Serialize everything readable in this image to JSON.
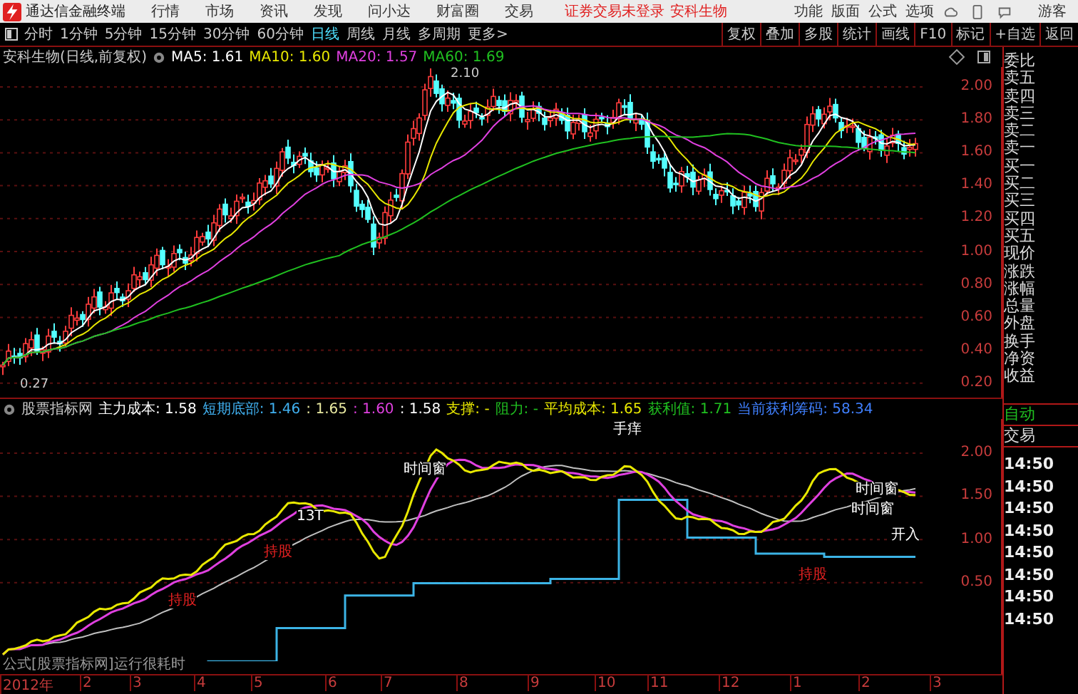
{
  "app": {
    "title": "通达信金融终端"
  },
  "menu": [
    "行情",
    "市场",
    "资讯",
    "发现",
    "问小达",
    "财富圈",
    "交易"
  ],
  "notice": [
    {
      "text": "证券交易未登录"
    },
    {
      "text": "安科生物"
    }
  ],
  "right_menu": [
    "功能",
    "版面",
    "公式",
    "选项"
  ],
  "user": "游客",
  "periods": [
    {
      "label": "分时",
      "selected": false
    },
    {
      "label": "1分钟",
      "selected": false
    },
    {
      "label": "5分钟",
      "selected": false
    },
    {
      "label": "15分钟",
      "selected": false
    },
    {
      "label": "30分钟",
      "selected": false
    },
    {
      "label": "60分钟",
      "selected": false
    },
    {
      "label": "日线",
      "selected": true
    },
    {
      "label": "周线",
      "selected": false
    },
    {
      "label": "月线",
      "selected": false
    },
    {
      "label": "多周期",
      "selected": false
    },
    {
      "label": "更多>",
      "selected": false
    }
  ],
  "tools": [
    "复权",
    "叠加",
    "多股",
    "统计",
    "画线",
    "F10",
    "标记",
    "+自选",
    "返回"
  ],
  "chart": {
    "title": "安科生物(日线,前复权)",
    "ma": [
      {
        "label": "MA5: 1.61",
        "color": "#ffffff"
      },
      {
        "label": "MA10: 1.60",
        "color": "#e8e800"
      },
      {
        "label": "MA20: 1.57",
        "color": "#e040e0"
      },
      {
        "label": "MA60: 1.69",
        "color": "#20c020"
      }
    ],
    "high_label": "2.10",
    "low_label": "0.27",
    "price_axis": [
      "2.00",
      "1.80",
      "1.60",
      "1.40",
      "1.20",
      "1.00",
      "0.80",
      "0.60",
      "0.40",
      "0.20"
    ]
  },
  "quote_panel": [
    "委比",
    "卖五",
    "卖四",
    "卖三",
    "卖二",
    "卖一",
    "买一",
    "买二",
    "买三",
    "买四",
    "买五",
    "现价",
    "涨跌",
    "涨幅",
    "总量",
    "外盘",
    "换手",
    "净资",
    "收益"
  ],
  "indicator": {
    "name": "股票指标网",
    "values": [
      {
        "label": "主力成本: 1.58",
        "color": "#ffffff"
      },
      {
        "label": "短期底部: 1.46",
        "color": "#40b0f0"
      },
      {
        "label": ": 1.65",
        "color": "#e8e8a0"
      },
      {
        "label": ": 1.60",
        "color": "#e040e0"
      },
      {
        "label": ": 1.58",
        "color": "#ffffff"
      },
      {
        "label": "支撑: -",
        "color": "#e8e800"
      },
      {
        "label": "阻力: -",
        "color": "#20c020"
      },
      {
        "label": "平均成本: 1.65",
        "color": "#e8e800"
      },
      {
        "label": "获利值: 1.71",
        "color": "#20c020"
      },
      {
        "label": "当前获利筹码: 58.34",
        "color": "#4080ff"
      }
    ],
    "axis": [
      "2.00",
      "1.50",
      "1.00",
      "0.50"
    ],
    "signals": [
      "手痒",
      "时间窗",
      "13T",
      "时间窗",
      "持股",
      "持股",
      "持股",
      "开入",
      "时间窗"
    ],
    "status": "公式[股票指标网]运行很耗时"
  },
  "trade_panel": {
    "mode": "自动",
    "title": "交易",
    "times": [
      "14:50",
      "14:50",
      "14:50",
      "14:50",
      "14:50",
      "14:50",
      "14:50",
      "14:50"
    ]
  },
  "date_axis": [
    "2012年",
    "2",
    "3",
    "4",
    "5",
    "6",
    "7",
    "8",
    "9",
    "10",
    "11",
    "12",
    "1",
    "2",
    "3"
  ]
}
